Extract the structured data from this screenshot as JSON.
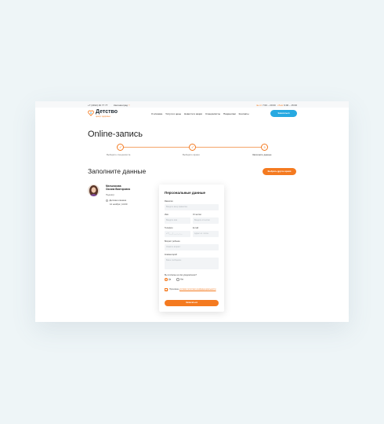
{
  "topbar": {
    "phone": "+7 (4012) 40 77 77",
    "city": "Калининград",
    "hours_weekday_label": "пн-пт",
    "hours_weekday": "7:00 – 20:00",
    "hours_weekend_label": "сб-вс",
    "hours_weekend": "9:00 – 15:00"
  },
  "header": {
    "logo_name": "Детство",
    "logo_sub": "центр здоровья",
    "nav": [
      "О клинике",
      "Услуги и цены",
      "Новости и акции",
      "Специалисты",
      "Пациентам",
      "Контакты"
    ],
    "cta": "Записаться"
  },
  "page_title": "Online-запись",
  "steps": [
    {
      "label": "Выберите специалиста",
      "state": "done"
    },
    {
      "label": "Выберите время",
      "state": "done"
    },
    {
      "label": "Заполните данные",
      "state": "active",
      "number": "3"
    }
  ],
  "section_title": "Заполните данные",
  "back_button": "Выбрать другое время",
  "doctor": {
    "surname": "Мельникова",
    "name": "Оксана Викторовна",
    "specialty": "Педиатр",
    "clinic": "Детская клиника",
    "time": "12 ноября | 14:00"
  },
  "form": {
    "title": "Персональные данные",
    "surname": {
      "label": "Фамилия",
      "placeholder": "Введите вашу фамилию"
    },
    "name": {
      "label": "Имя",
      "placeholder": "Введите имя"
    },
    "patronymic": {
      "label": "Отчество",
      "placeholder": "Введите отчество"
    },
    "phone": {
      "label": "Телефон",
      "placeholder": "+7 (___) ___-__-__"
    },
    "email": {
      "label": "E-mail",
      "placeholder": "Адрес эл. почты"
    },
    "child_age": {
      "label": "Возраст ребенка",
      "placeholder": "Укажите возраст"
    },
    "comment": {
      "label": "Комментарий",
      "placeholder": "Ваше сообщение"
    },
    "reminder_question": "Вы согласны на смс-уведомление?",
    "yes": "Да",
    "no": "Нет",
    "agree_text": "Принимаю",
    "agree_link": "условия политики конфиденциальности",
    "submit": "Записаться"
  },
  "colors": {
    "accent": "#f47a20",
    "secondary": "#27a9e1",
    "background": "#eef5f7"
  }
}
